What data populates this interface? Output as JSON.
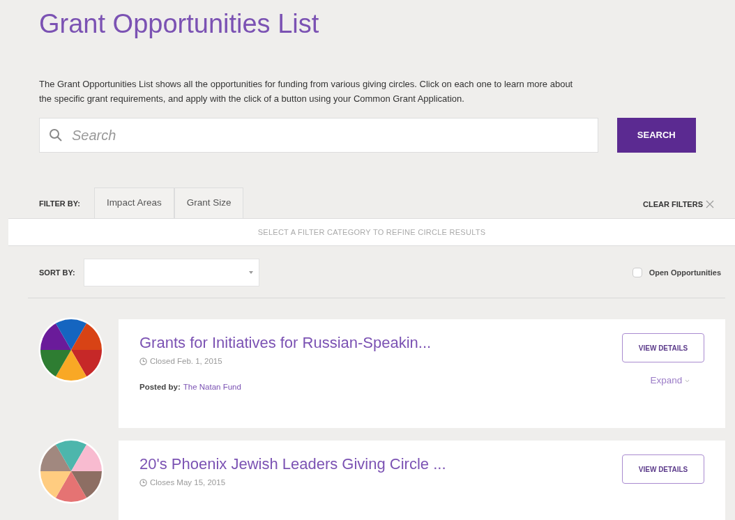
{
  "title": "Grant Opportunities List",
  "intro": "The Grant Opportunities List shows all the opportunities for funding from various giving circles. Click on each one to learn more about the specific grant requirements, and apply with the click of a button using your Common Grant Application.",
  "search": {
    "placeholder": "Search",
    "button": "SEARCH"
  },
  "filter": {
    "label": "FILTER BY:",
    "tabs": [
      {
        "label": "Impact Areas",
        "selected": false
      },
      {
        "label": "Grant Size",
        "selected": false
      }
    ],
    "clear": "CLEAR FILTERS",
    "hint": "SELECT A FILTER CATEGORY TO REFINE CIRCLE RESULTS"
  },
  "sort": {
    "label": "SORT BY:",
    "checkbox": {
      "label": "Open Opportunities",
      "checked": false
    }
  },
  "grants": [
    {
      "title": "Grants for Initiatives for Russian-Speakin...",
      "date": "Closed Feb. 1, 2015",
      "posted_label": "Posted by:",
      "posted_by": "The Natan Fund",
      "button": "VIEW DETAILS",
      "expand": "Expand"
    },
    {
      "title": "20's Phoenix Jewish Leaders Giving Circle ...",
      "date": "Closes May 15, 2015",
      "button": "VIEW DETAILS"
    }
  ]
}
